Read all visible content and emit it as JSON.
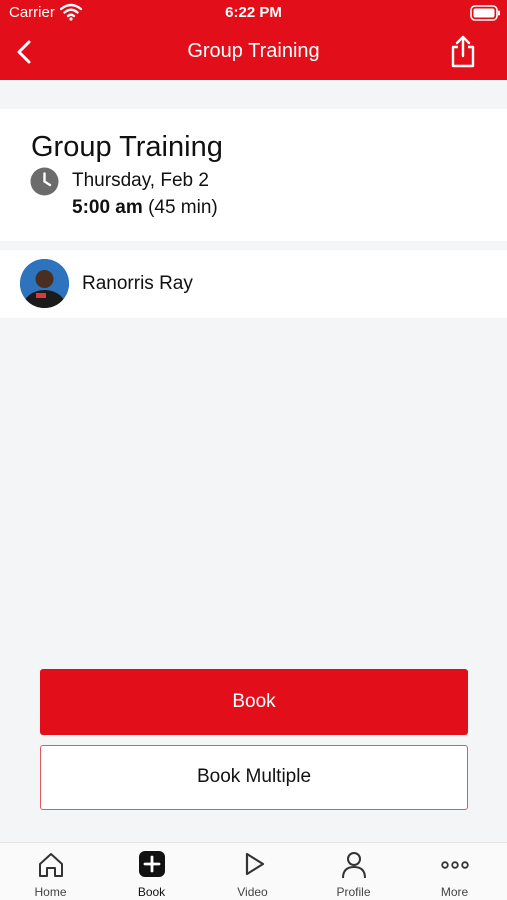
{
  "status_bar": {
    "carrier": "Carrier",
    "time": "6:22 PM"
  },
  "nav": {
    "title": "Group Training"
  },
  "session": {
    "title": "Group Training",
    "date": "Thursday, Feb 2",
    "start_time": "5:00 am",
    "duration": "(45 min)"
  },
  "trainer": {
    "name": "Ranorris Ray"
  },
  "actions": {
    "book_label": "Book",
    "book_multiple_label": "Book Multiple"
  },
  "tabbar": {
    "items": [
      {
        "label": "Home",
        "icon": "home-icon"
      },
      {
        "label": "Book",
        "icon": "plus-square-icon",
        "active": true
      },
      {
        "label": "Video",
        "icon": "play-icon"
      },
      {
        "label": "Profile",
        "icon": "person-icon"
      },
      {
        "label": "More",
        "icon": "more-icon"
      }
    ]
  },
  "colors": {
    "brand": "#e20f1a",
    "background": "#f4f5f7",
    "outline": "#e05a61"
  }
}
